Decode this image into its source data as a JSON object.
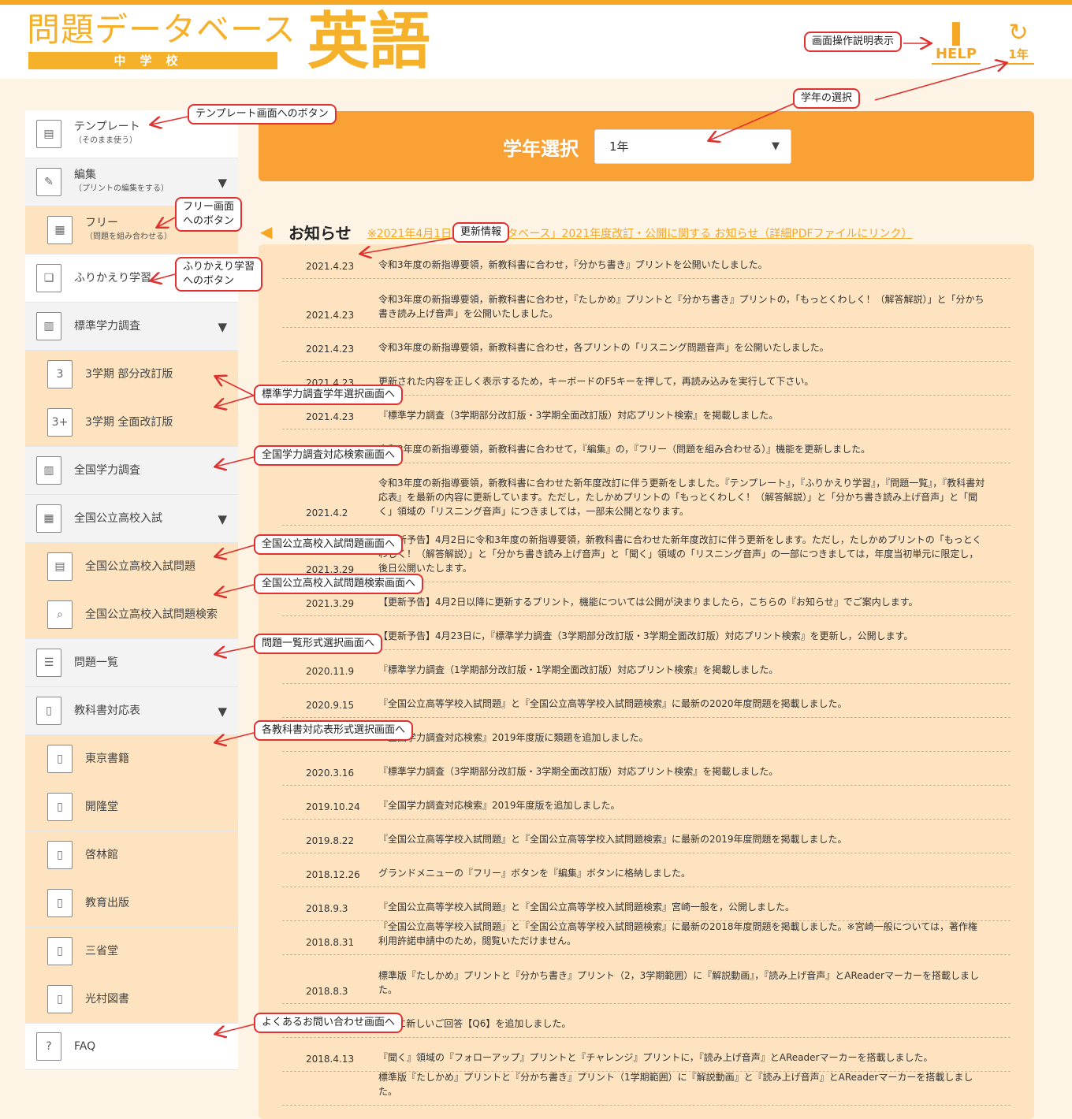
{
  "header": {
    "logo_main": "問題データベース",
    "logo_sub": "中学校",
    "subject": "英語",
    "help_label": "HELP",
    "grade_label": "1年"
  },
  "sidebar": {
    "items": [
      {
        "label": "テンプレート",
        "sub": "（そのまま使う）",
        "icon": "template-icon"
      },
      {
        "label": "編集",
        "sub": "（プリントの編集をする）",
        "icon": "edit-icon"
      },
      {
        "label": "フリー",
        "sub": "（問題を組み合わせる）",
        "icon": "free-icon"
      },
      {
        "label": "ふりかえり学習",
        "sub": "",
        "icon": "review-icon"
      },
      {
        "label": "標準学力調査",
        "sub": "",
        "icon": "bar-chart-icon"
      },
      {
        "label": "3学期 部分改訂版",
        "sub": "",
        "icon": "calendar-3-icon"
      },
      {
        "label": "3学期 全面改訂版",
        "sub": "",
        "icon": "calendar-3plus-icon"
      },
      {
        "label": "全国学力調査",
        "sub": "",
        "icon": "nation-chart-icon"
      },
      {
        "label": "全国公立高校入試",
        "sub": "",
        "icon": "school-icon"
      },
      {
        "label": "全国公立高校入試問題",
        "sub": "",
        "icon": "document-icon"
      },
      {
        "label": "全国公立高校入試問題検索",
        "sub": "",
        "icon": "document-search-icon"
      },
      {
        "label": "問題一覧",
        "sub": "",
        "icon": "list-icon"
      },
      {
        "label": "教科書対応表",
        "sub": "",
        "icon": "book-icon"
      },
      {
        "label": "東京書籍",
        "sub": "",
        "icon": "file-icon"
      },
      {
        "label": "開隆堂",
        "sub": "",
        "icon": "file-icon"
      },
      {
        "label": "啓林館",
        "sub": "",
        "icon": "file-icon"
      },
      {
        "label": "教育出版",
        "sub": "",
        "icon": "file-icon"
      },
      {
        "label": "三省堂",
        "sub": "",
        "icon": "file-icon"
      },
      {
        "label": "光村図書",
        "sub": "",
        "icon": "file-icon"
      },
      {
        "label": "FAQ",
        "sub": "",
        "icon": "faq-icon"
      }
    ]
  },
  "grade_selector": {
    "label": "学年選択",
    "value": "1年"
  },
  "news": {
    "title": "お知らせ",
    "link": "※2021年4月1日「問題データベース」2021年度改訂・公開に関する お知らせ（詳細PDFファイルにリンク）",
    "items": [
      {
        "date": "2021.4.23",
        "text": "令和3年度の新指導要領，新教科書に合わせ，『分かち書き』プリントを公開いたしました。"
      },
      {
        "date": "2021.4.23",
        "text": "令和3年度の新指導要領，新教科書に合わせ，『たしかめ』プリントと『分かち書き』プリントの，「もっとくわしく！（解答解説）」と「分かち書き読み上げ音声」を公開いたしました。"
      },
      {
        "date": "2021.4.23",
        "text": "令和3年度の新指導要領，新教科書に合わせ，各プリントの「リスニング問題音声」を公開いたしました。"
      },
      {
        "date": "2021.4.23",
        "text": "更新された内容を正しく表示するため，キーボードのF5キーを押して，再読み込みを実行して下さい。"
      },
      {
        "date": "2021.4.23",
        "text": "『標準学力調査（3学期部分改訂版・3学期全面改訂版）対応プリント検索』を掲載しました。"
      },
      {
        "date": "",
        "text": "令和3年度の新指導要領，新教科書に合わせて，『編集』の，『フリー（問題を組み合わせる）』機能を更新しました。"
      },
      {
        "date": "2021.4.2",
        "text": "令和3年度の新指導要領，新教科書に合わせた新年度改訂に伴う更新をしました。『テンプレート』，『ふりかえり学習』，『問題一覧』，『教科書対応表』を最新の内容に更新しています。ただし，たしかめプリントの「もっとくわしく！（解答解説）」と「分かち書き読み上げ音声」と「聞く」領域の「リスニング音声」につきましては，一部未公開となります。"
      },
      {
        "date": "2021.3.29",
        "text": "【更新予告】4月2日に令和3年度の新指導要領，新教科書に合わせた新年度改訂に伴う更新をします。ただし，たしかめプリントの「もっとくわしく！（解答解説）」と「分かち書き読み上げ音声」と「聞く」領域の「リスニング音声」の一部につきましては，年度当初単元に限定し，後日公開いたします。"
      },
      {
        "date": "2021.3.29",
        "text": "【更新予告】4月2日以降に更新するプリント，機能については公開が決まりましたら，こちらの『お知らせ』でご案内します。"
      },
      {
        "date": "",
        "text": "【更新予告】4月23日に，『標準学力調査（3学期部分改訂版・3学期全面改訂版）対応プリント検索』を更新し，公開します。"
      },
      {
        "date": "2020.11.9",
        "text": "『標準学力調査（1学期部分改訂版・1学期全面改訂版）対応プリント検索』を掲載しました。"
      },
      {
        "date": "2020.9.15",
        "text": "『全国公立高等学校入試問題』と『全国公立高等学校入試問題検索』に最新の2020年度問題を掲載しました。"
      },
      {
        "date": "",
        "text": "『全国学力調査対応検索』2019年度版に類題を追加しました。"
      },
      {
        "date": "2020.3.16",
        "text": "『標準学力調査（3学期部分改訂版・3学期全面改訂版）対応プリント検索』を掲載しました。"
      },
      {
        "date": "2019.10.24",
        "text": "『全国学力調査対応検索』2019年度版を追加しました。"
      },
      {
        "date": "2019.8.22",
        "text": "『全国公立高等学校入試問題』と『全国公立高等学校入試問題検索』に最新の2019年度問題を掲載しました。"
      },
      {
        "date": "2018.12.26",
        "text": "グランドメニューの『フリー』ボタンを『編集』ボタンに格納しました。"
      },
      {
        "date": "2018.9.3",
        "text": "『全国公立高等学校入試問題』と『全国公立高等学校入試問題検索』宮崎一般を，公開しました。"
      },
      {
        "date": "2018.8.31",
        "text": "『全国公立高等学校入試問題』と『全国公立高等学校入試問題検索』に最新の2018年度問題を掲載しました。※宮崎一般については，著作権利用許諾申請中のため，閲覧いただけません。"
      },
      {
        "date": "2018.8.3",
        "text": "標準版『たしかめ』プリントと『分かち書き』プリント（2，3学期範囲）に『解説動画』，『読み上げ音声』とAReaderマーカーを搭載しました。"
      },
      {
        "date": "2018.4.25",
        "text": "FAQに新しいご回答【Q6】を追加しました。"
      },
      {
        "date": "2018.4.13",
        "text": "『聞く』領域の『フォローアップ』プリントと『チャレンジ』プリントに，『読み上げ音声』とAReaderマーカーを搭載しました。"
      },
      {
        "date": "",
        "text": "標準版『たしかめ』プリントと『分かち書き』プリント（1学期範囲）に『解説動画』と『読み上げ音声』とAReaderマーカーを搭載しました。"
      }
    ]
  },
  "callouts": [
    "画面操作説明表示",
    "学年の選択",
    "テンプレート画面へのボタン",
    "フリー画面\nへのボタン",
    "更新情報",
    "ふりかえり学習\nへのボタン",
    "標準学力調査学年選択画面へ",
    "全国学力調査対応検索画面へ",
    "全国公立高校入試問題画面へ",
    "全国公立高校入試問題検索画面へ",
    "問題一覧形式選択画面へ",
    "各教科書対応表形式選択画面へ",
    "よくあるお問い合わせ画面へ"
  ],
  "colors": {
    "accent": "#f5a623",
    "panel": "#f9a134",
    "news_bg": "#fde3c0",
    "callout_border": "#e0312f"
  }
}
